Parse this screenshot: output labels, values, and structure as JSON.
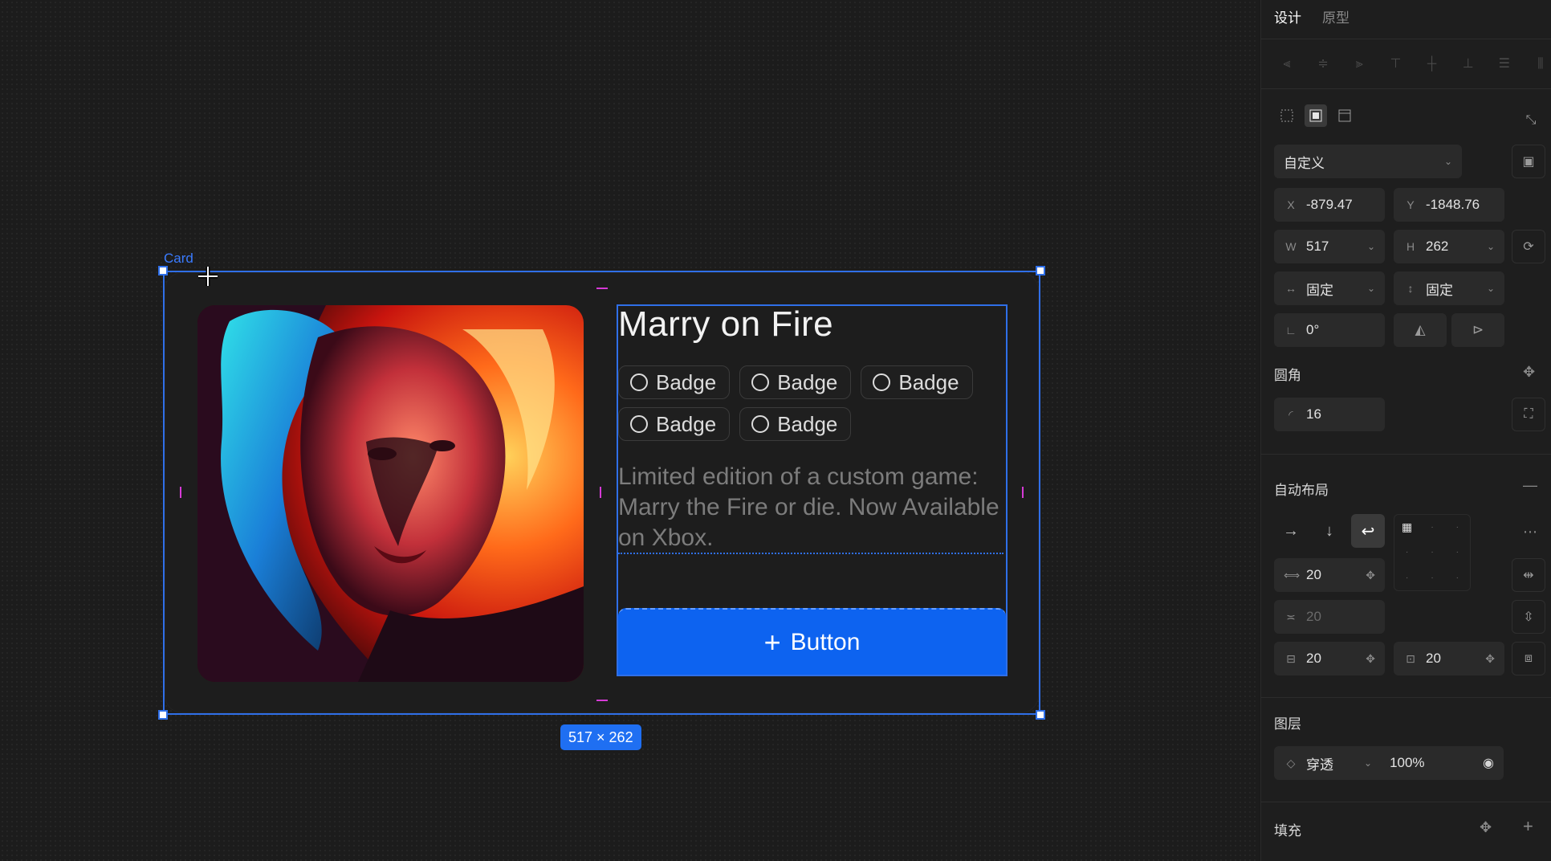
{
  "canvas": {
    "frame_label": "Card",
    "size_tag": "517 × 262",
    "card": {
      "title": "Marry on Fire",
      "badges": [
        "Badge",
        "Badge",
        "Badge",
        "Badge",
        "Badge"
      ],
      "description": "Limited edition of a custom game: Marry the Fire or die. Now Available on Xbox.",
      "button_label": "Button"
    },
    "colors": {
      "selection": "#2f6fe8",
      "button": "#0d63f0",
      "guide": "#d63ad6"
    }
  },
  "panel": {
    "tabs": [
      {
        "label": "设计",
        "active": true
      },
      {
        "label": "原型",
        "active": false
      }
    ],
    "preset": "自定义",
    "x_label": "X",
    "x_value": "-879.47",
    "y_label": "Y",
    "y_value": "-1848.76",
    "w_label": "W",
    "w_value": "517",
    "h_label": "H",
    "h_value": "262",
    "w_sizing": "固定",
    "h_sizing": "固定",
    "rotation": "0°",
    "corner": {
      "title": "圆角",
      "value": "16"
    },
    "auto_layout": {
      "title": "自动布局",
      "gap": "20",
      "row_gap": "20",
      "padding_v": "20",
      "padding_h": "20"
    },
    "layer": {
      "title": "图层",
      "blend": "穿透",
      "opacity": "100%"
    },
    "fill": {
      "title": "填充"
    }
  }
}
